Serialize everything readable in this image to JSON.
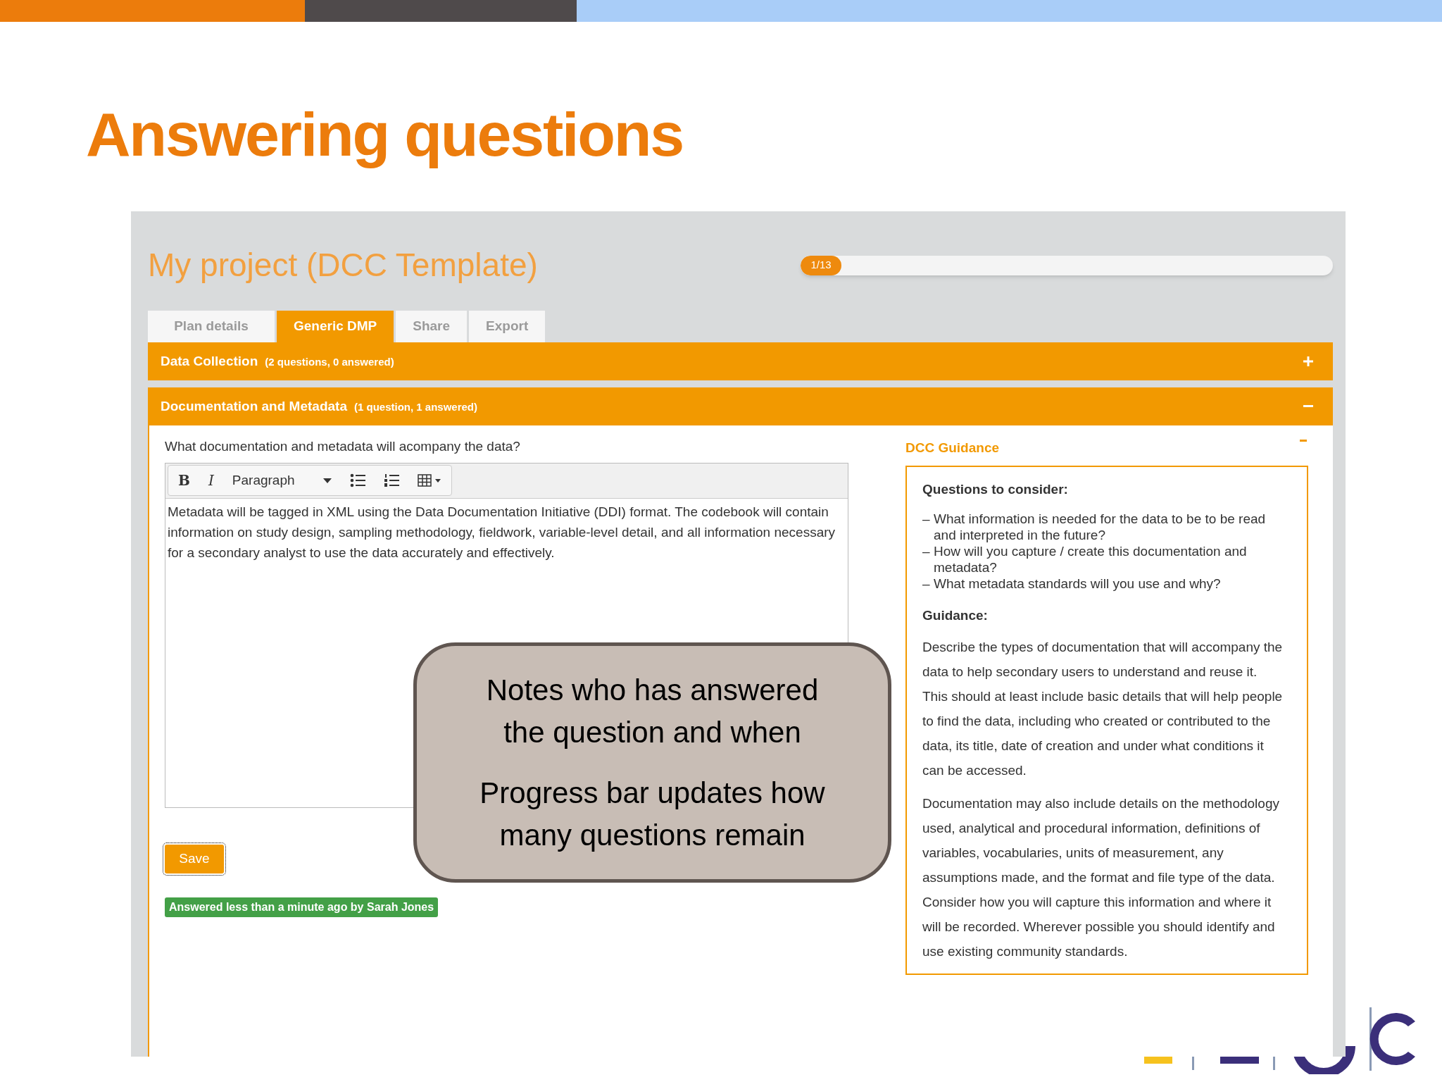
{
  "slide_title": "Answering questions",
  "app": {
    "project_title": "My project (DCC Template)",
    "progress": {
      "label": "1/13",
      "level": 0.077
    },
    "tabs": [
      {
        "label": "Plan details",
        "selected": false
      },
      {
        "label": "Generic DMP",
        "selected": true
      },
      {
        "label": "Share",
        "selected": false
      },
      {
        "label": "Export",
        "selected": false
      }
    ],
    "sections": [
      {
        "title": "Data Collection",
        "summary": "(2 questions, 0 answered)",
        "expanded": false
      },
      {
        "title": "Documentation and Metadata",
        "summary": "(1 question, 1 answered)",
        "expanded": true
      }
    ],
    "question": "What documentation and metadata will acompany the data?",
    "editor": {
      "bold_button": "B",
      "italic_button": "I",
      "format": "Paragraph",
      "value": "Metadata will be tagged in XML using the Data Documentation Initiative (DDI) format. The codebook will contain information on study design, sampling methodology, fieldwork, variable-level detail, and all information necessary for a secondary analyst to use the data accurately and effectively."
    },
    "save_button": "Save",
    "answered_note": "Answered less than a minute ago by Sarah Jones",
    "guidance": {
      "title": "DCC Guidance",
      "expanded": true,
      "heading_1": "Questions to consider:",
      "bullets": [
        "What information is needed for the data to be to be read and interpreted in the future?",
        "How will you capture / create this documentation and metadata?",
        "What metadata standards will you use and why?"
      ],
      "bullet_marker": "–",
      "heading_2": "Guidance:",
      "paragraphs": [
        "Describe the types of documentation that will accompany the data to help secondary users to understand and reuse it. This should at least include basic details that will help people to find the data, including who created or contributed to the data, its title, date of creation and under what conditions it can be accessed.",
        "Documentation may also include details on the methodology used, analytical and procedural information, definitions of variables, vocabularies, units of measurement, any assumptions made, and the format and file type of the data. Consider how you will capture this information and where it will be recorded. Wherever possible you should identify and use existing community standards."
      ]
    }
  },
  "callout": [
    "Notes who has answered the question and when",
    "Progress bar updates how many questions remain"
  ]
}
